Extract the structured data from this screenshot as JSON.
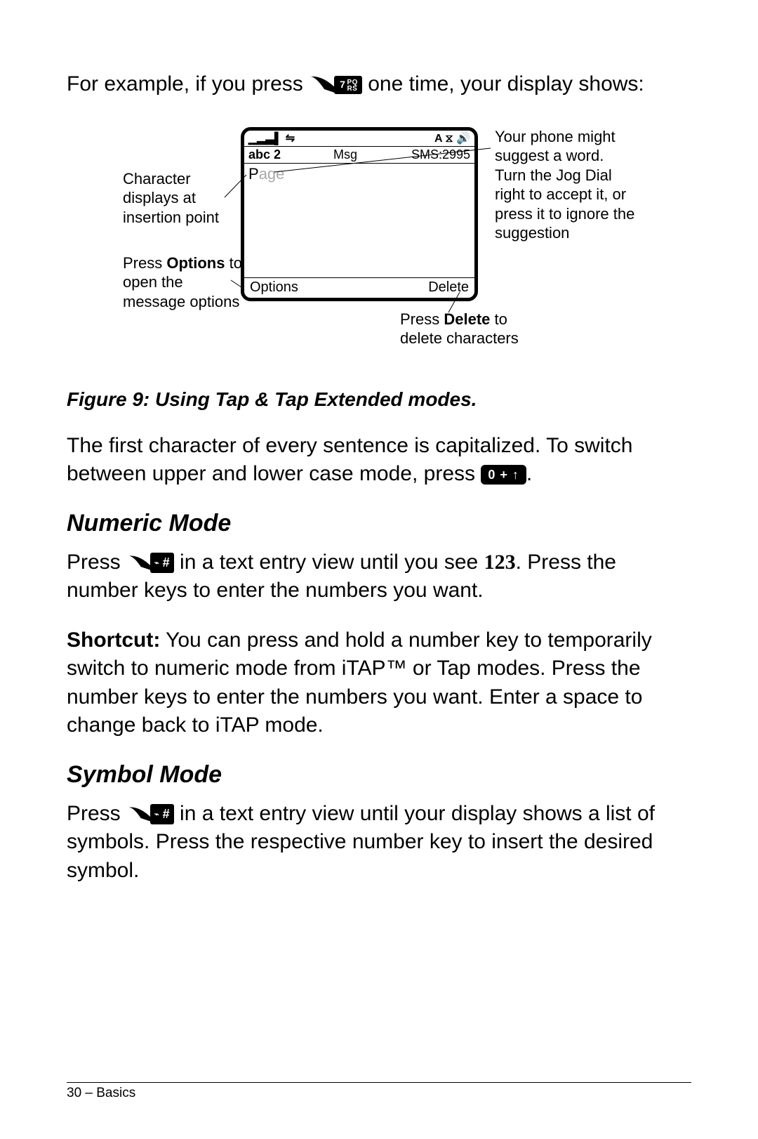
{
  "intro": {
    "pre": "For example, if you press ",
    "key7": "7",
    "key7_letters_top": "PQ",
    "key7_letters_bot": "RS",
    "post": " one time, your display shows:"
  },
  "screen": {
    "status_left": "▁▂▃▌ ⇋",
    "status_right": "A ⧖ 🔊",
    "mode": "abc 2",
    "title": "Msg",
    "sms": "SMS:2995",
    "typed_char": "P",
    "suggestion": "age",
    "soft_left": "Options",
    "soft_right": "Delete"
  },
  "callouts": {
    "char": "Character displays at insertion point",
    "options_pre": "Press ",
    "options_bold": "Options",
    "options_post": " to open the message options",
    "suggestion": "Your phone might suggest a word. Turn the Jog Dial right to accept it, or press it to ignore the suggestion",
    "delete_pre": "Press ",
    "delete_bold": "Delete",
    "delete_post": " to delete characters"
  },
  "figure_caption": "Figure 9: Using Tap & Tap Extended modes.",
  "para_caps_pre": "The first character of every sentence is capitalized. To switch between upper and lower case mode, press ",
  "para_caps_key": "0 + ↑",
  "para_caps_post": ".",
  "numeric": {
    "heading": "Numeric Mode",
    "p1_pre": "Press ",
    "p1_hash": "#",
    "p1_mid": " in a text entry view until you see ",
    "p1_indicator": "123",
    "p1_post": ". Press the number keys to enter the numbers you want.",
    "shortcut_label": "Shortcut:",
    "shortcut_body": " You can press and hold a number key to temporarily switch to numeric mode from iTAP™ or Tap modes. Press the number keys to enter the numbers you want. Enter a space to change back to iTAP mode."
  },
  "symbol": {
    "heading": "Symbol Mode",
    "p1_pre": "Press ",
    "p1_hash": "#",
    "p1_post": " in a text entry view until your display shows a list of symbols. Press the respective number key to insert the desired symbol."
  },
  "footer": "30 – Basics"
}
